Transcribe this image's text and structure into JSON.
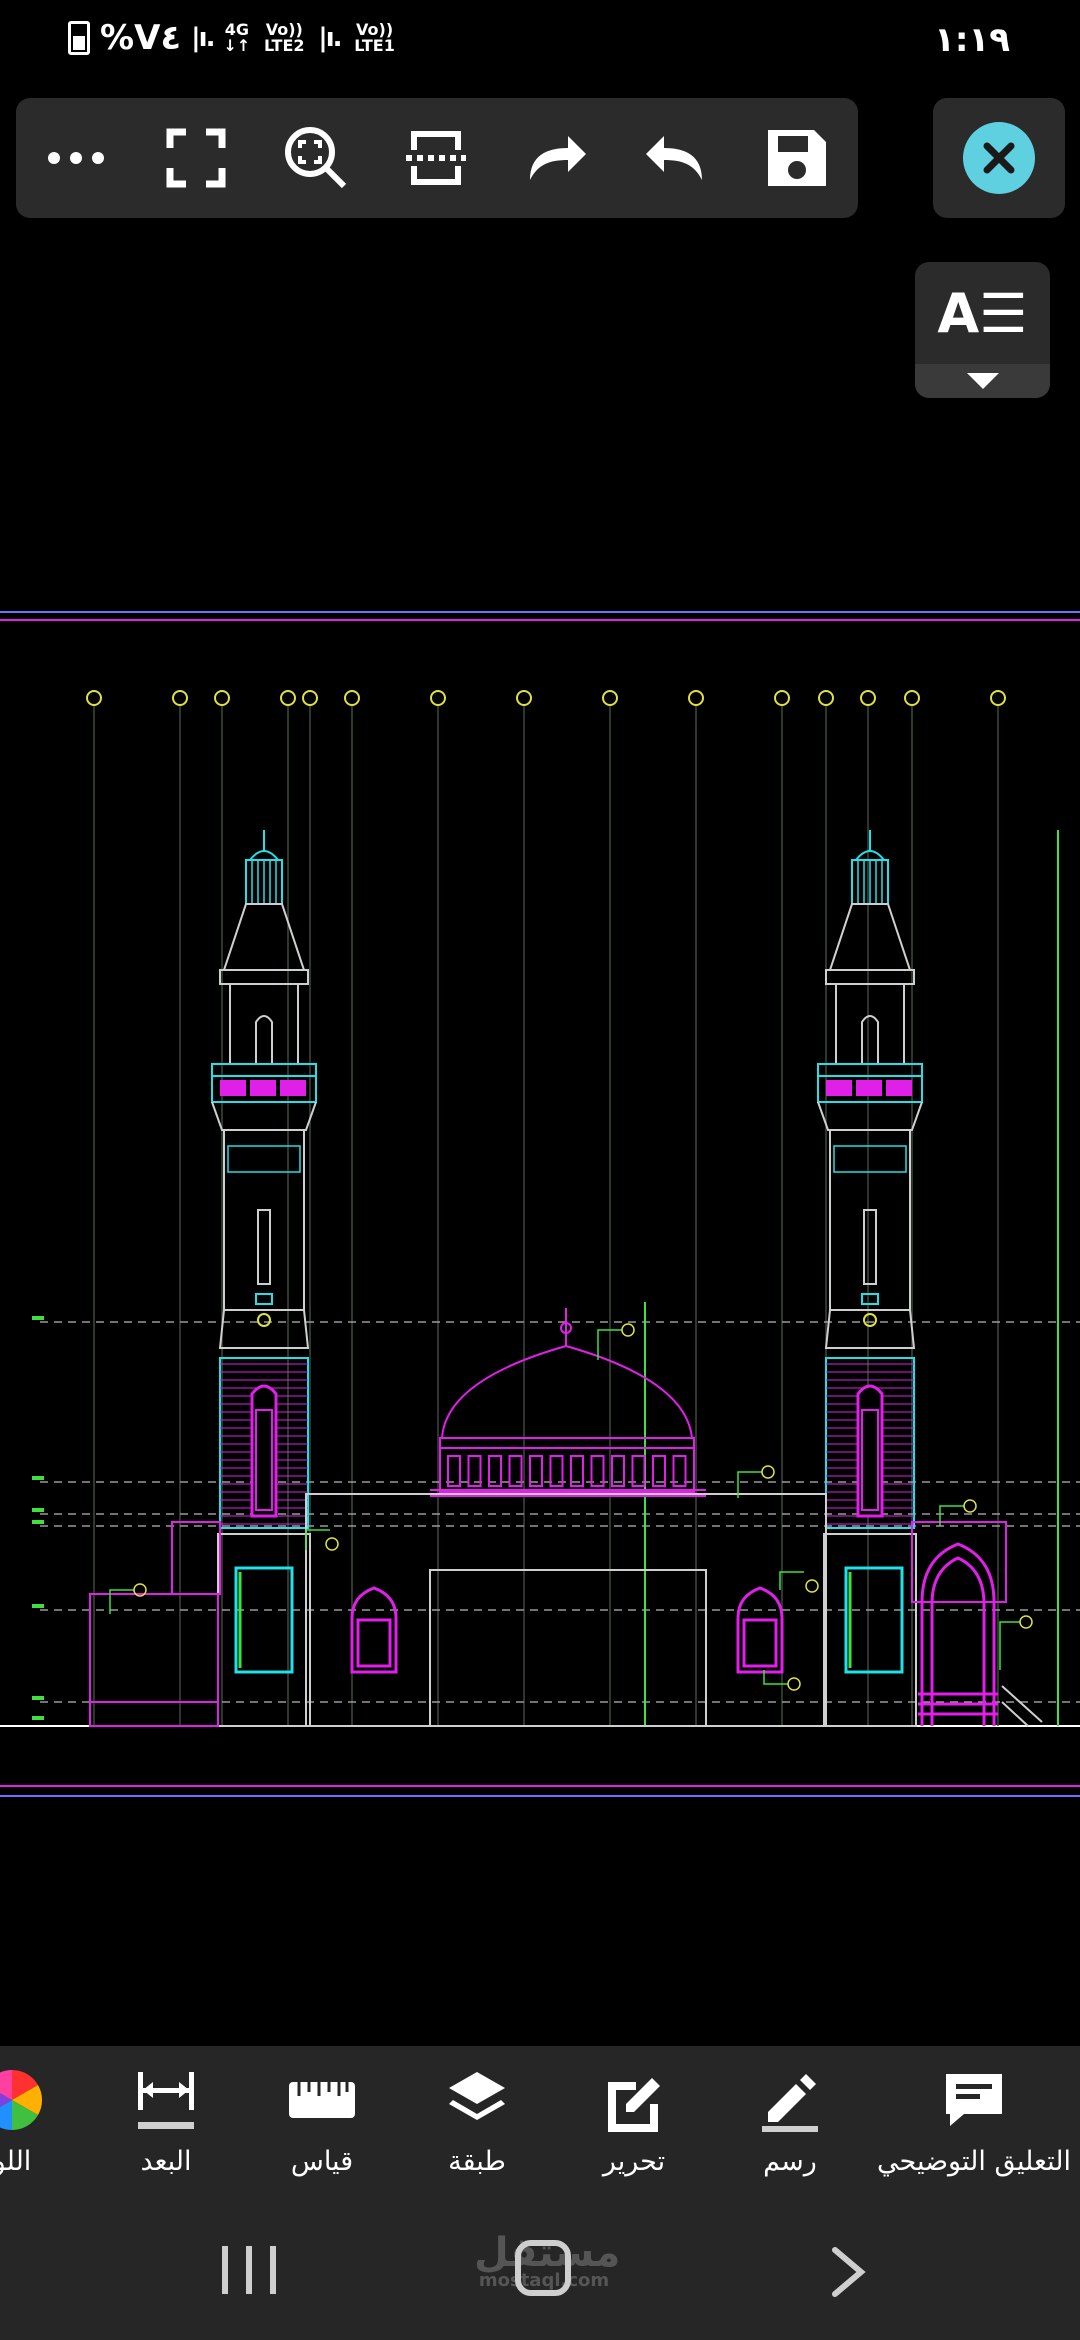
{
  "status": {
    "battery": "%V٤",
    "network_1": "4G",
    "network_1_sub": "↓↑",
    "volte_2": "Vo)) LTE2",
    "volte_1": "Vo)) LTE1",
    "time": "١:١٩"
  },
  "toolbar": {
    "icons": [
      "more-icon",
      "fullscreen-icon",
      "zoom-fit-icon",
      "section-icon",
      "redo-icon",
      "undo-icon",
      "save-icon"
    ]
  },
  "textstyle": {
    "glyph": "A☰"
  },
  "bottom": {
    "items": [
      {
        "label": "التعليق التوضيحي",
        "icon": "annotation-icon"
      },
      {
        "label": "رسم",
        "icon": "draw-pen-icon"
      },
      {
        "label": "تحرير",
        "icon": "edit-icon"
      },
      {
        "label": "طبقة",
        "icon": "layers-icon"
      },
      {
        "label": "قياس",
        "icon": "ruler-icon"
      },
      {
        "label": "البعد",
        "icon": "dimension-icon"
      },
      {
        "label": "اللو",
        "icon": "color-wheel-icon"
      }
    ]
  },
  "watermark": {
    "text": "مستقل",
    "sub": "mostaql.com"
  },
  "colors": {
    "cyan": "#22e0e8",
    "magenta": "#e020e8",
    "green": "#40e040",
    "yellow": "#e0e040",
    "panel": "#2b2b2b"
  }
}
